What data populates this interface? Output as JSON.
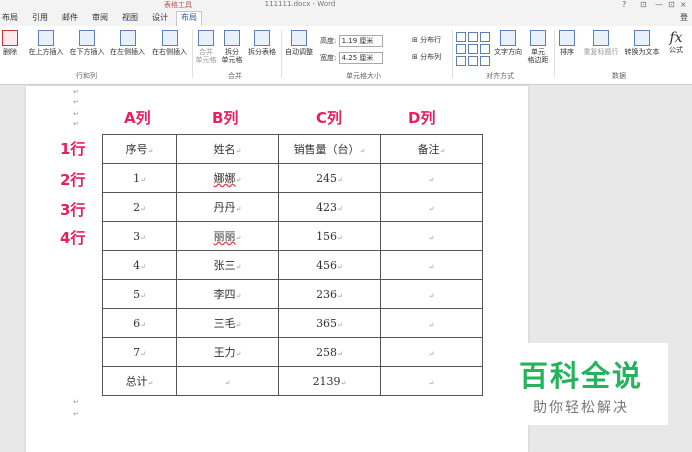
{
  "title": {
    "context_group": "表格工具",
    "document": "111111.docx - Word",
    "controls": [
      "?",
      "⊡",
      "—",
      "⊡",
      "×"
    ],
    "user": "登"
  },
  "tabs": [
    "布局",
    "引用",
    "邮件",
    "审阅",
    "视图",
    "设计",
    "布局"
  ],
  "ribbon": {
    "buttons": {
      "delete": "删除",
      "insert_above": "在上方插入",
      "insert_below": "在下方插入",
      "insert_left": "在左侧插入",
      "insert_right": "在右侧插入",
      "merge": "合并",
      "merge2": "单元格",
      "split": "拆分",
      "split2": "单元格",
      "split_table": "拆分表格",
      "autofit": "自动调整",
      "text_dir": "文字方向",
      "margins": "单元",
      "margins2": "格边距",
      "sort": "排序",
      "repeat_header": "重复标题行",
      "convert": "转换为文本",
      "formula": "公式"
    },
    "height_label": "高度:",
    "height_value": "1.19 厘米",
    "width_label": "宽度:",
    "width_value": "4.25 厘米",
    "dist_rows": "分布行",
    "dist_cols": "分布列",
    "groups": {
      "rows_cols": "行和列",
      "merge": "合并",
      "cell_size": "单元格大小",
      "align": "对齐方式",
      "data": "数据"
    }
  },
  "col_labels": [
    "A列",
    "B列",
    "C列",
    "D列"
  ],
  "row_labels": [
    "1行",
    "2行",
    "3行",
    "4行"
  ],
  "table": {
    "header": [
      "序号",
      "姓名",
      "销售量（台）",
      "备注"
    ],
    "rows": [
      [
        "1",
        "娜娜",
        "245",
        ""
      ],
      [
        "2",
        "丹丹",
        "423",
        ""
      ],
      [
        "3",
        "丽丽",
        "156",
        ""
      ],
      [
        "4",
        "张三",
        "456",
        ""
      ],
      [
        "5",
        "李四",
        "236",
        ""
      ],
      [
        "6",
        "三毛",
        "365",
        ""
      ],
      [
        "7",
        "王力",
        "258",
        ""
      ]
    ],
    "total": [
      "总计",
      "",
      "2139",
      ""
    ]
  },
  "watermark": {
    "main": "百科全说",
    "sub": "助你轻松解决"
  },
  "colors": {
    "annotation": "#e8205f",
    "watermark_green": "#25b35b",
    "active_tab": "#2b579a"
  }
}
